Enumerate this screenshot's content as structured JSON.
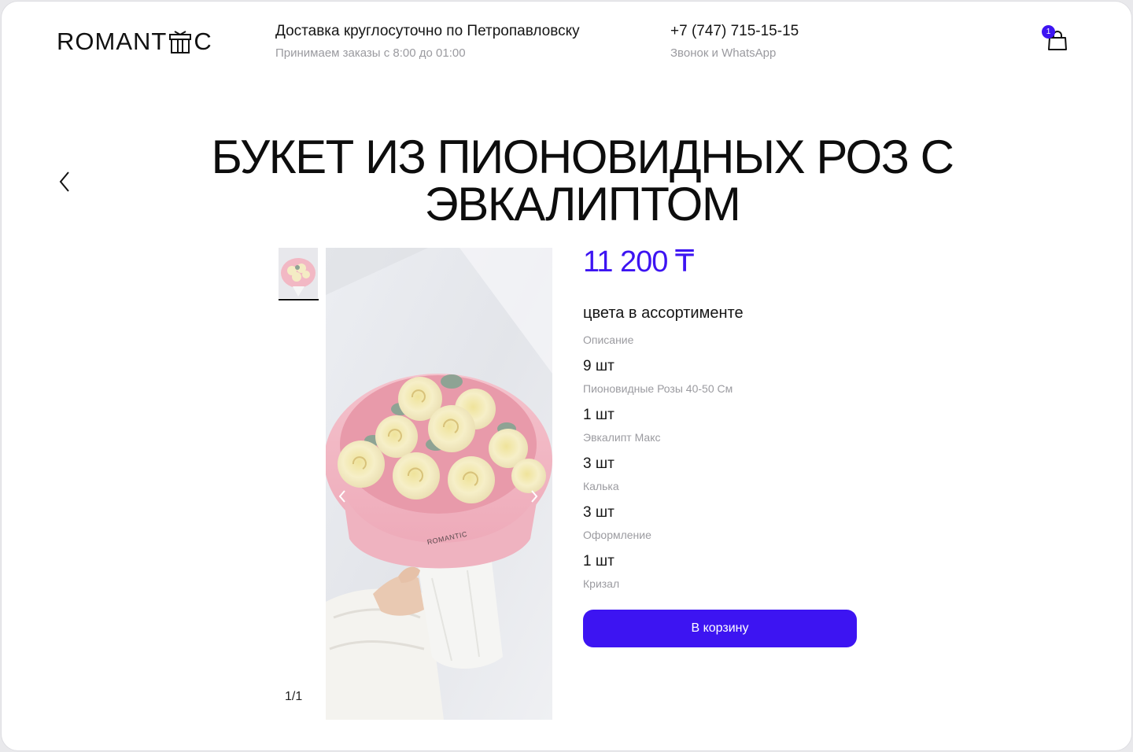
{
  "header": {
    "logo_text": "ROMANTIC",
    "delivery_title": "Доставка круглосуточно по Петропавловску",
    "delivery_hours": "Принимаем заказы с 8:00 до 01:00",
    "phone": "+7 (747) 715-15-15",
    "phone_note": "Звонок и WhatsApp",
    "cart_count": "1"
  },
  "product": {
    "title": "БУКЕТ ИЗ ПИОНОВИДНЫХ РОЗ С ЭВКАЛИПТОМ",
    "price": "11 200 ₸",
    "colors_note": "цвета в ассортименте",
    "description_label": "Описание",
    "composition": [
      {
        "qty": "9 шт",
        "name": "Пионовидные Розы 40-50 См"
      },
      {
        "qty": "1 шт",
        "name": "Эвкалипт Макс"
      },
      {
        "qty": "3 шт",
        "name": "Калька"
      },
      {
        "qty": "3 шт",
        "name": "Оформление"
      },
      {
        "qty": "1 шт",
        "name": "Кризал"
      }
    ],
    "add_to_cart_label": "В корзину",
    "wrap_logo": "ROMANTIC"
  },
  "gallery": {
    "counter": "1/1"
  },
  "colors": {
    "accent": "#3d14f2",
    "wrap_pink": "#f2b8c4",
    "rose_cream": "#f4ecc4",
    "eucalyptus": "#8ea394"
  }
}
